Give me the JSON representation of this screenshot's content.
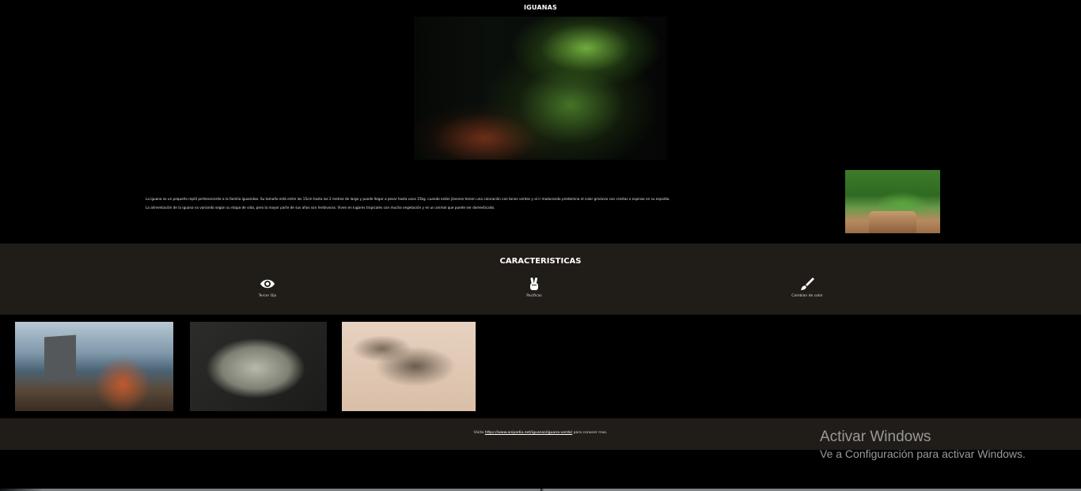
{
  "header": {
    "title": "IGUANAS"
  },
  "intro": {
    "paragraph_1": "La iguana es un pequeño reptil perteneciente a la familia iguanidae. Su tamaño está entre los 15cm hasta los 2 metros de largo y puede llegar a pesar hasta unos 15kg. cuando están jóvenes tienen una coloración con tonos verdes y al ir madurando predomina el color grisáceo con crestas o espinas en su espalda.",
    "paragraph_2": "La alimentación de la iguana va variando según su etapa de vida, pero la mayor parte de sus años son herbívoras. Viven en lugares tropicales con mucha vegetación y es un animal que puede ser domesticado."
  },
  "features": {
    "title": "CARACTERISTICAS",
    "items": [
      {
        "label": "Tercer Ojo",
        "icon": "eye-icon"
      },
      {
        "label": "Pacificas",
        "icon": "peace-hand-icon"
      },
      {
        "label": "Cambian de color",
        "icon": "paint-brush-icon"
      }
    ]
  },
  "footer": {
    "prefix": "Visita",
    "link_text": "https://www.anipedia.net/iguanas/iguana-verde/",
    "suffix": "para conocer mas."
  },
  "windows_watermark": {
    "title": "Activar Windows",
    "subtitle": "Ve a Configuración para activar Windows."
  },
  "colors": {
    "background": "#000000",
    "band": "#201c17",
    "text": "#ffffff"
  }
}
